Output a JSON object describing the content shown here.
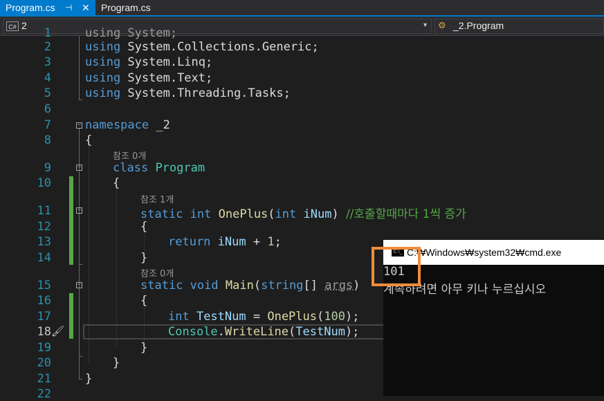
{
  "tabs": {
    "active_label": "Program.cs",
    "pin_glyph": "⊣",
    "close_glyph": "✕",
    "second_label": "Program.cs"
  },
  "navbar": {
    "project_badge": "C#",
    "project": "2",
    "dropdown_glyph": "▼",
    "class_icon_glyph": "⚙",
    "class_path": "_2.Program"
  },
  "code_lens": {
    "class_refs": "참조 0개",
    "oneplus_refs": "참조 1개",
    "main_refs": "참조 0개"
  },
  "code": {
    "line1": "using System;",
    "using_kw": "using",
    "line2_ns": " System.Collections.Generic;",
    "line3_ns": " System.Linq;",
    "line4_ns": " System.Text;",
    "line5_ns": " System.Threading.Tasks;",
    "namespace_kw": "namespace",
    "namespace_name": " _2",
    "open_brace": "{",
    "close_brace": "}",
    "class_kw": "class",
    "class_name": "Program",
    "static_kw": "static",
    "int_kw": "int",
    "oneplus": "OnePlus",
    "inum": "iNum",
    "comment": "//호출할때마다 1씩 증가",
    "return_kw": "return",
    "plus_one": " + ",
    "one": "1",
    "void_kw": "void",
    "main": "Main",
    "string_kw": "string",
    "args": "args",
    "testnum": "TestNum",
    "hundred": "100",
    "console": "Console",
    "writeline": "WriteLine"
  },
  "line_numbers": [
    "2",
    "3",
    "4",
    "5",
    "6",
    "7",
    "8",
    "9",
    "10",
    "11",
    "12",
    "13",
    "14",
    "15",
    "16",
    "17",
    "18",
    "19",
    "20",
    "21",
    "22"
  ],
  "line_one_partial": "1",
  "cmd": {
    "title": "C:₩Windows₩system32₩cmd.exe",
    "icon_text": "C:\\_",
    "output_line1": "101",
    "output_line2": "계속하려면 아무 키나 누르십시오"
  }
}
